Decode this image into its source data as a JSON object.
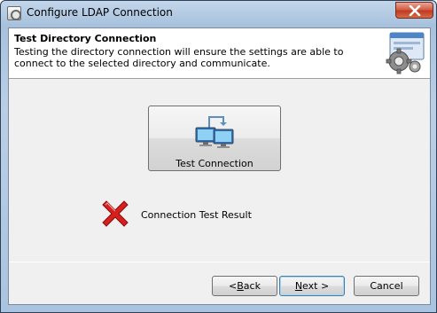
{
  "window": {
    "title": "Configure LDAP Connection",
    "close_label": "×"
  },
  "header": {
    "title": "Test Directory Connection",
    "description": "Testing the directory connection will ensure the settings are able to connect to the selected directory and communicate.",
    "icon": "gear-window-icon"
  },
  "main": {
    "test_button": {
      "label": "Test Connection",
      "icon": "network-computers-icon"
    },
    "result": {
      "label": "Connection Test Result",
      "status": "failed",
      "icon": "red-x-icon"
    }
  },
  "footer": {
    "back": {
      "mnemonic": "B",
      "rest": "ack",
      "prefix": "< "
    },
    "next": {
      "mnemonic": "N",
      "rest": "ext >"
    },
    "cancel": {
      "label": "Cancel"
    }
  },
  "colors": {
    "title_gradient": "#a7c1dd",
    "close_red": "#c03a1f",
    "error_red": "#d01010"
  }
}
